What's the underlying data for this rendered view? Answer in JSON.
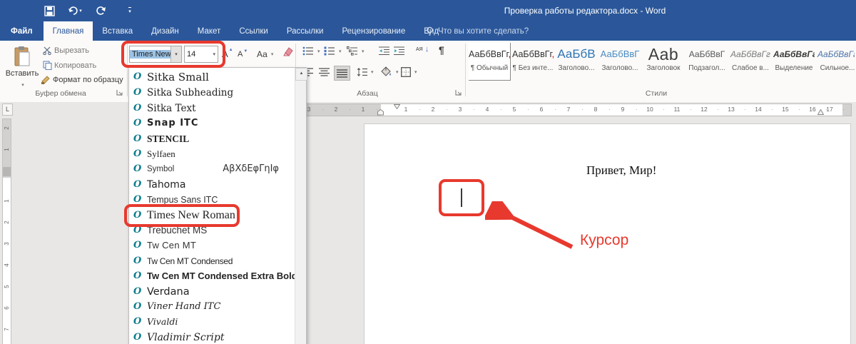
{
  "colors": {
    "accent_blue": "#2b579a",
    "annotation_red": "#e8392e",
    "heading_blue": "#2e74b5",
    "opentype_teal": "#0e7d8c"
  },
  "titlebar": {
    "title": "Проверка работы редактора.docx - Word"
  },
  "tabs": [
    {
      "label": "Файл"
    },
    {
      "label": "Главная"
    },
    {
      "label": "Вставка"
    },
    {
      "label": "Дизайн"
    },
    {
      "label": "Макет"
    },
    {
      "label": "Ссылки"
    },
    {
      "label": "Рассылки"
    },
    {
      "label": "Рецензирование"
    },
    {
      "label": "Вид"
    }
  ],
  "tellme": {
    "label": "Что вы хотите сделать?"
  },
  "ribbon": {
    "clipboard": {
      "paste_label": "Вставить",
      "cut_label": "Вырезать",
      "copy_label": "Копировать",
      "format_painter_label": "Формат по образцу",
      "group_label": "Буфер обмена"
    },
    "font": {
      "font_name": "Times New R",
      "font_size": "14",
      "grow_glyph": "А",
      "shrink_glyph": "А",
      "change_case_glyph": "Аа"
    },
    "paragraph": {
      "group_label": "Абзац",
      "sort_letters": "АЯ",
      "sort_arrow": "↓",
      "pilcrow": "¶"
    },
    "styles": {
      "group_label": "Стили",
      "items": [
        {
          "preview": "АаБбВвГг",
          "suffix": ",",
          "label": "¶ Обычный",
          "style": "n"
        },
        {
          "preview": "АаБбВвГг",
          "suffix": ",",
          "label": "¶ Без инте...",
          "style": "n"
        },
        {
          "preview": "АаБбВ",
          "label": "Заголово...",
          "style": "h1"
        },
        {
          "preview": "АаБбВвГ",
          "label": "Заголово...",
          "style": "h2"
        },
        {
          "preview": "Аab",
          "label": "Заголовок",
          "style": "title"
        },
        {
          "preview": "АаБбВвГ",
          "label": "Подзагол...",
          "style": "sub"
        },
        {
          "preview": "АаБбВвГг",
          "label": "Слабое в...",
          "style": "em"
        },
        {
          "preview": "АаБбВвГг",
          "label": "Выделение",
          "style": "emb"
        },
        {
          "preview": "АаБбВвГг",
          "label": "Сильное...",
          "style": "emblue"
        }
      ]
    }
  },
  "ruler": {
    "corner": "L",
    "h_left": [
      "3",
      "2",
      "1"
    ],
    "h_numbers": [
      "1",
      "2",
      "3",
      "4",
      "5",
      "6",
      "7",
      "8",
      "9",
      "10",
      "11",
      "12",
      "13",
      "14",
      "15",
      "16"
    ],
    "h_right": "17",
    "v_top": [
      "2",
      "1"
    ],
    "v_numbers": [
      "1",
      "2",
      "3",
      "4",
      "5",
      "6",
      "7"
    ]
  },
  "font_dropdown": {
    "icon_glyph": "O",
    "items": [
      {
        "name": "Sitka Small",
        "style": "sitka1"
      },
      {
        "name": "Sitka Subheading",
        "style": "sitka2"
      },
      {
        "name": "Sitka Text",
        "style": "sitka2"
      },
      {
        "name": "Snap ITC",
        "style": "snap"
      },
      {
        "name": "STENCIL",
        "style": "stencil"
      },
      {
        "name": "Sylfaen",
        "style": "sylfaen"
      },
      {
        "name": "Symbol",
        "style": "symbol",
        "preview": "ΑβΧδΕφΓηΙφ"
      },
      {
        "name": "Tahoma",
        "style": "tahoma"
      },
      {
        "name": "Tempus Sans ITC",
        "style": "tempus"
      },
      {
        "name": "Times New Roman",
        "style": "times"
      },
      {
        "name": "Trebuchet MS",
        "style": "trebuchet"
      },
      {
        "name": "Tw Cen MT",
        "style": "twcen"
      },
      {
        "name": "Tw Cen MT Condensed",
        "style": "twcencond"
      },
      {
        "name": "Tw Cen MT Condensed Extra Bold",
        "style": "twcenxb"
      },
      {
        "name": "Verdana",
        "style": "verdana"
      },
      {
        "name": "Viner Hand ITC",
        "style": "viner"
      },
      {
        "name": "Vivaldi",
        "style": "vivaldi"
      },
      {
        "name": "Vladimir Script",
        "style": "vladimir"
      }
    ],
    "scroll_up_glyph": "▲"
  },
  "document": {
    "text": "Привет, Мир!",
    "annotation_label": "Курсор"
  }
}
